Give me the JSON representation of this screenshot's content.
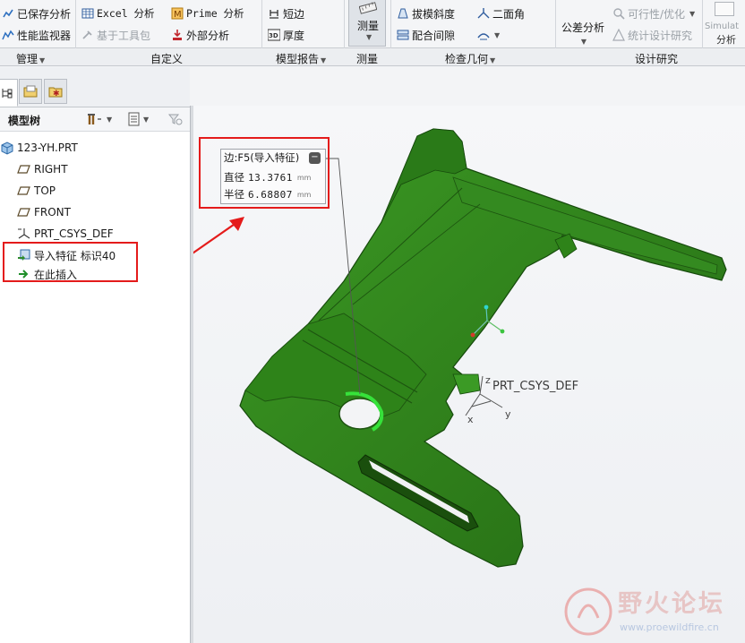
{
  "ribbon": {
    "saved_analysis": "已保存分析",
    "perf_monitor": "性能监视器",
    "excel_analysis": "Excel 分析",
    "toolkit_based": "基于工具包",
    "prime_analysis": "Prime 分析",
    "external_analysis": "外部分析",
    "short_edge": "短边",
    "thickness": "厚度",
    "measure": "测量",
    "draft": "拔模斜度",
    "clearance": "配合间隙",
    "dihedral": "二面角",
    "tolerance_analysis": "公差分析",
    "feasibility": "可行性/优化",
    "stat_design": "统计设计研究",
    "simulate": "Simulat",
    "simulate_analysis": "分析",
    "thickness_icon_text": "3D"
  },
  "groups": {
    "manage": "管理",
    "custom": "自定义",
    "model_report": "模型报告",
    "measure": "测量",
    "inspect_geometry": "检查几何",
    "design_study": "设计研究"
  },
  "tree": {
    "title": "模型树",
    "items": [
      {
        "label": "123-YH.PRT"
      },
      {
        "label": "RIGHT"
      },
      {
        "label": "TOP"
      },
      {
        "label": "FRONT"
      },
      {
        "label": "PRT_CSYS_DEF"
      },
      {
        "label": "导入特征 标识40"
      },
      {
        "label": "在此插入"
      }
    ]
  },
  "callout": {
    "title": "边:F5(导入特征)",
    "diameter_label": "直径",
    "diameter_value": "13.3761",
    "radius_label": "半径",
    "radius_value": "6.68807",
    "unit": "mm"
  },
  "viewport": {
    "csys_label": "PRT_CSYS_DEF",
    "axis_x": "x",
    "axis_y": "y",
    "axis_z": "z"
  },
  "watermark": {
    "name": "野火论坛",
    "url": "www.proewildfire.cn"
  },
  "colors": {
    "model_green": "#2f7d1e",
    "model_dark": "#1d5410",
    "highlight_red": "#e41b1b",
    "hole_highlight": "#36e23a"
  }
}
